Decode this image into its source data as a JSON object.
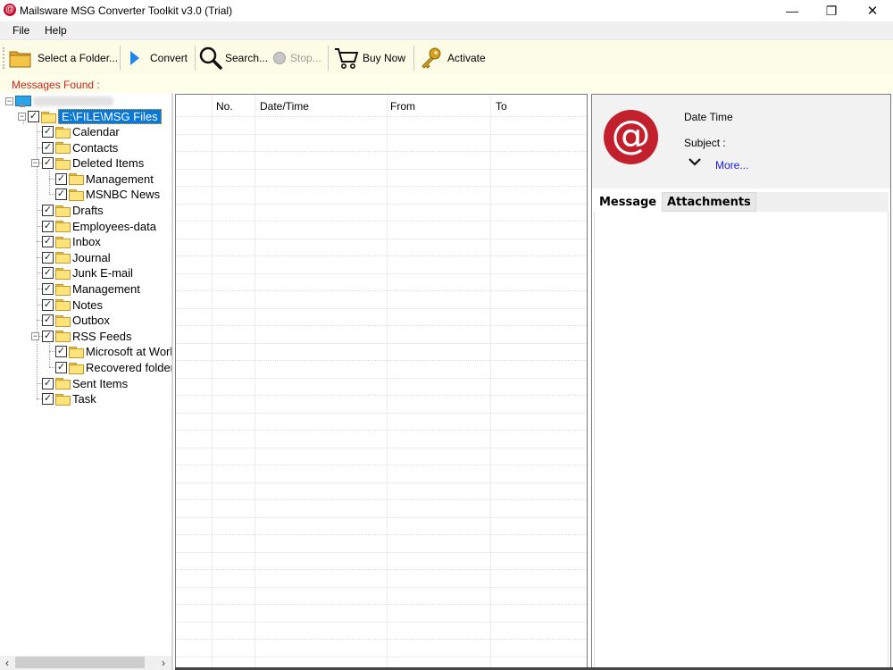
{
  "window": {
    "title": "Mailsware MSG Converter Toolkit v3.0 (Trial)",
    "app_icon": "at-sign-icon",
    "controls": {
      "minimize": "—",
      "maximize": "❐",
      "close": "✕"
    }
  },
  "menu": {
    "items": [
      {
        "label": "File"
      },
      {
        "label": "Help"
      }
    ]
  },
  "toolbar": {
    "select_folder": "Select a Folder...",
    "convert": "Convert",
    "search": "Search...",
    "stop": "Stop...",
    "buy_now": "Buy Now",
    "activate": "Activate"
  },
  "status": {
    "messages_found": "Messages Found :",
    "color": "#d0201a"
  },
  "tree": {
    "root_label": "",
    "selected": "E:\\FILE\\MSG Files",
    "items": [
      {
        "label": "Calendar",
        "level": 1
      },
      {
        "label": "Contacts",
        "level": 1
      },
      {
        "label": "Deleted Items",
        "level": 1,
        "expanded": true
      },
      {
        "label": "Management",
        "level": 2
      },
      {
        "label": "MSNBC News",
        "level": 2
      },
      {
        "label": "Drafts",
        "level": 1
      },
      {
        "label": "Employees-data",
        "level": 1
      },
      {
        "label": "Inbox",
        "level": 1
      },
      {
        "label": "Journal",
        "level": 1
      },
      {
        "label": "Junk E-mail",
        "level": 1
      },
      {
        "label": "Management",
        "level": 1
      },
      {
        "label": "Notes",
        "level": 1
      },
      {
        "label": "Outbox",
        "level": 1
      },
      {
        "label": "RSS Feeds",
        "level": 1,
        "expanded": true
      },
      {
        "label": "Microsoft at Work",
        "level": 2
      },
      {
        "label": "Recovered folder",
        "level": 2
      },
      {
        "label": "Sent Items",
        "level": 1
      },
      {
        "label": "Task",
        "level": 1
      }
    ],
    "checkbox_mark": "✓",
    "expander_mark": "−"
  },
  "message_list": {
    "columns": [
      "",
      "No.",
      "Date/Time",
      "From",
      "To"
    ],
    "rows": []
  },
  "preview": {
    "date_time_label": "Date Time",
    "subject_label": "Subject :",
    "more_link": "More...",
    "chevron": "⌄",
    "at_symbol": "@",
    "tabs": [
      "Message",
      "Attachments"
    ],
    "link_color": "#1a1ae8",
    "icon_color": "#c3202e"
  },
  "scrollbar": {
    "left_arrow": "‹",
    "right_arrow": "›"
  }
}
